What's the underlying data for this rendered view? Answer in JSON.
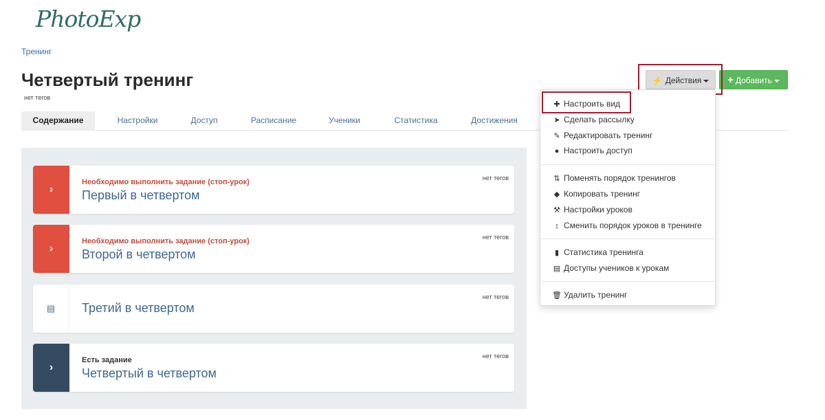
{
  "logo": "PhotoExp",
  "breadcrumb": "Тренинг",
  "page_title": "Четвертый тренинг",
  "no_tags": "нет тегов",
  "tabs": [
    "Содержание",
    "Настройки",
    "Доступ",
    "Расписание",
    "Ученики",
    "Статистика",
    "Достижения"
  ],
  "buttons": {
    "actions": "Действия",
    "add": "Добавить"
  },
  "menu": [
    {
      "label": "Настроить вид",
      "icon": "puzzle-icon"
    },
    {
      "label": "Сделать рассылку",
      "icon": "paper-plane-icon"
    },
    {
      "label": "Редактировать тренинг",
      "icon": "edit-icon"
    },
    {
      "label": "Настроить доступ",
      "icon": "user-icon"
    },
    {
      "label": "Поменять порядок тренингов",
      "icon": "sort-icon"
    },
    {
      "label": "Копировать тренинг",
      "icon": "tags-icon"
    },
    {
      "label": "Настройки уроков",
      "icon": "wrench-icon"
    },
    {
      "label": "Сменить порядок уроков в тренинге",
      "icon": "sort-arrows-icon"
    },
    {
      "label": "Статистика тренинга",
      "icon": "bar-chart-icon"
    },
    {
      "label": "Доступы учеников к урокам",
      "icon": "list-icon"
    },
    {
      "label": "Удалить тренинг",
      "icon": "trash-icon"
    }
  ],
  "lessons": [
    {
      "status": "Необходимо выполнить задание (стоп-урок)",
      "title": "Первый в четвертом",
      "tags": "нет тегов"
    },
    {
      "status": "Необходимо выполнить задание (стоп-урок)",
      "title": "Второй в четвертом",
      "tags": "нет тегов"
    },
    {
      "status": "",
      "title": "Третий в четвертом",
      "tags": "нет тегов"
    },
    {
      "status": "Есть задание",
      "title": "Четвертый в четвертом",
      "tags": "нет тегов"
    }
  ],
  "colors": {
    "primary_link": "#3b6ea5",
    "stop_lesson": "#e04f3f",
    "task_lesson": "#354b61",
    "add_button": "#5cb85c",
    "highlight": "#a51b2c"
  }
}
